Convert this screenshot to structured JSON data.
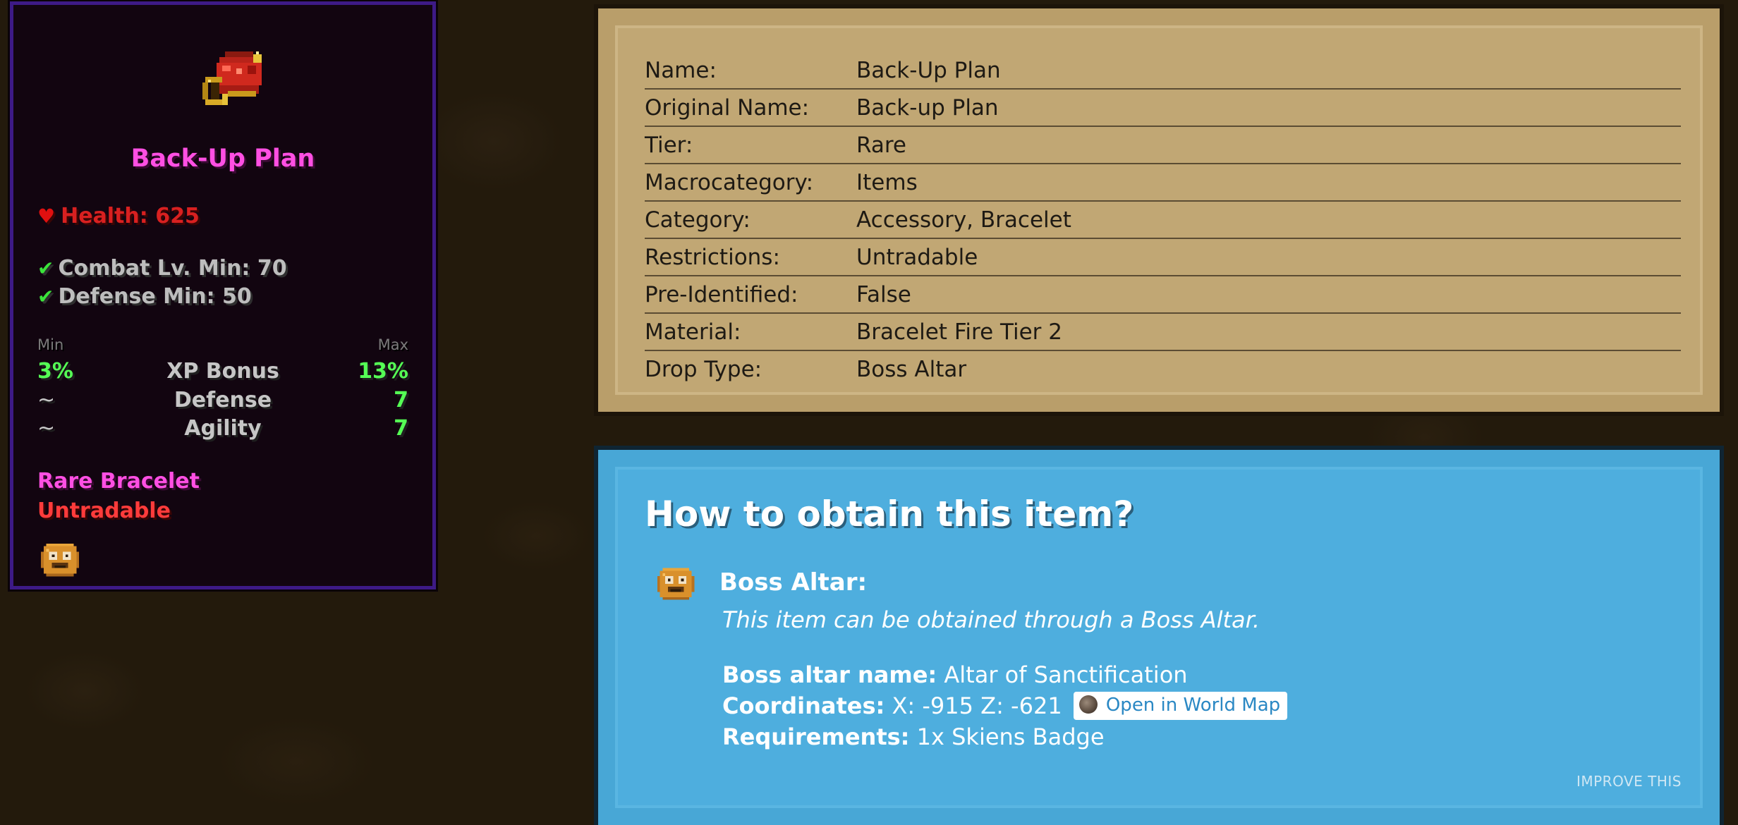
{
  "tooltip": {
    "title": "Back-Up Plan",
    "health": "Health: 625",
    "requirements": [
      "Combat Lv. Min: 70",
      "Defense Min: 50"
    ],
    "minmax_header": {
      "min": "Min",
      "max": "Max"
    },
    "identifications": [
      {
        "min": "3%",
        "name": "XP Bonus",
        "max": "13%"
      },
      {
        "min": "~",
        "name": "Defense",
        "max": "7"
      },
      {
        "min": "~",
        "name": "Agility",
        "max": "7"
      }
    ],
    "rarity_line": "Rare Bracelet",
    "trade_line": "Untradable"
  },
  "info_table": [
    {
      "key": "Name:",
      "value": "Back-Up Plan"
    },
    {
      "key": "Original Name:",
      "value": "Back-up Plan"
    },
    {
      "key": "Tier:",
      "value": "Rare"
    },
    {
      "key": "Macrocategory:",
      "value": "Items"
    },
    {
      "key": "Category:",
      "value": "Accessory, Bracelet"
    },
    {
      "key": "Restrictions:",
      "value": "Untradable"
    },
    {
      "key": "Pre-Identified:",
      "value": "False"
    },
    {
      "key": "Material:",
      "value": "Bracelet Fire Tier 2"
    },
    {
      "key": "Drop Type:",
      "value": "Boss Altar"
    }
  ],
  "obtain": {
    "title": "How to obtain this item?",
    "source_title": "Boss Altar:",
    "source_desc": "This item can be obtained through a Boss Altar.",
    "altar_name_label": "Boss altar name:",
    "altar_name_value": "Altar of Sanctification",
    "coords_label": "Coordinates:",
    "coords_value": "X: -915 Z: -621",
    "map_button": "Open in World Map",
    "requirements_label": "Requirements:",
    "requirements_value": "1x Skiens Badge",
    "improve_link": "IMPROVE THIS"
  },
  "colors": {
    "rarity": "#ff4fe3",
    "health": "#d82020",
    "positive": "#55ff55",
    "untradable": "#ff3b3b",
    "parchment": "#c1a774",
    "obtain_panel": "#4eaede"
  }
}
